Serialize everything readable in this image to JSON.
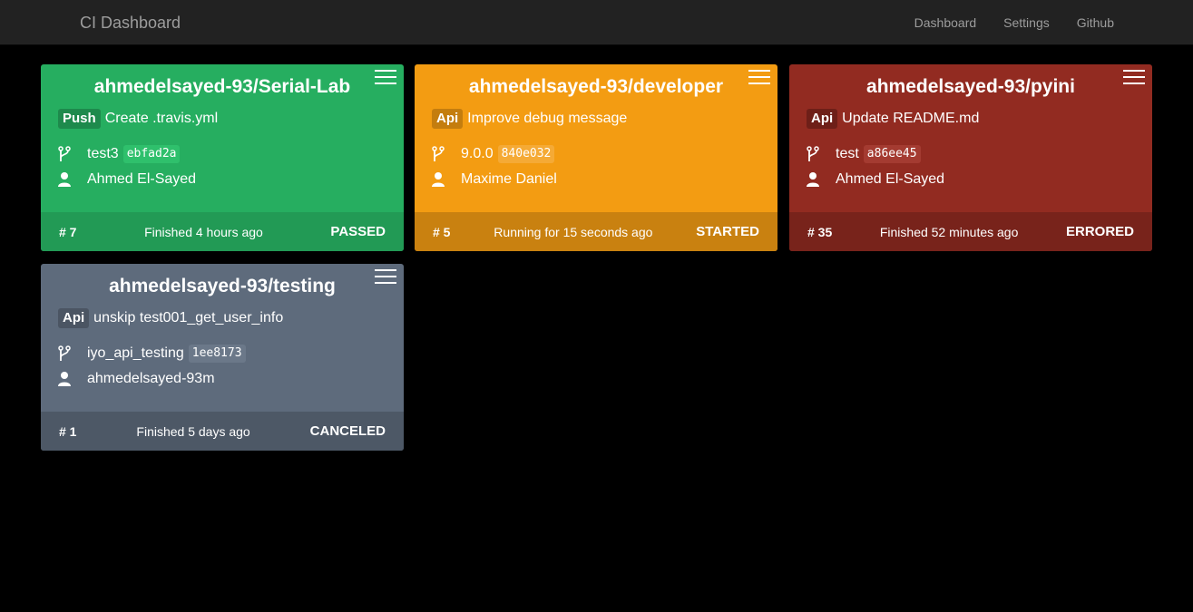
{
  "navbar": {
    "brand": "CI Dashboard",
    "links": [
      "Dashboard",
      "Settings",
      "Github"
    ]
  },
  "colors": {
    "passed": "#26AE60",
    "started": "#F39C12",
    "errored": "#922B21",
    "canceled": "#5E6B7C"
  },
  "builds": [
    {
      "repo": "ahmedelsayed-93/Serial-Lab",
      "event": "Push",
      "message": "Create .travis.yml",
      "branch": "test3",
      "sha": "ebfad2a",
      "author": "Ahmed El-Sayed",
      "number": "# 7",
      "time": "Finished 4 hours ago",
      "status": "PASSED"
    },
    {
      "repo": "ahmedelsayed-93/developer",
      "event": "Api",
      "message": "Improve debug message",
      "branch": "9.0.0",
      "sha": "840e032",
      "author": "Maxime Daniel",
      "number": "# 5",
      "time": "Running for 15 seconds ago",
      "status": "STARTED"
    },
    {
      "repo": "ahmedelsayed-93/pyini",
      "event": "Api",
      "message": "Update README.md",
      "branch": "test",
      "sha": "a86ee45",
      "author": "Ahmed El-Sayed",
      "number": "# 35",
      "time": "Finished 52 minutes ago",
      "status": "ERRORED"
    },
    {
      "repo": "ahmedelsayed-93/testing",
      "event": "Api",
      "message": "unskip test001_get_user_info",
      "branch": "iyo_api_testing",
      "sha": "1ee8173",
      "author": "ahmedelsayed-93m",
      "number": "# 1",
      "time": "Finished 5 days ago",
      "status": "CANCELED"
    }
  ],
  "icons": {
    "menu": "hamburger-menu-icon",
    "branch": "code-branch-icon",
    "author": "user-icon"
  }
}
